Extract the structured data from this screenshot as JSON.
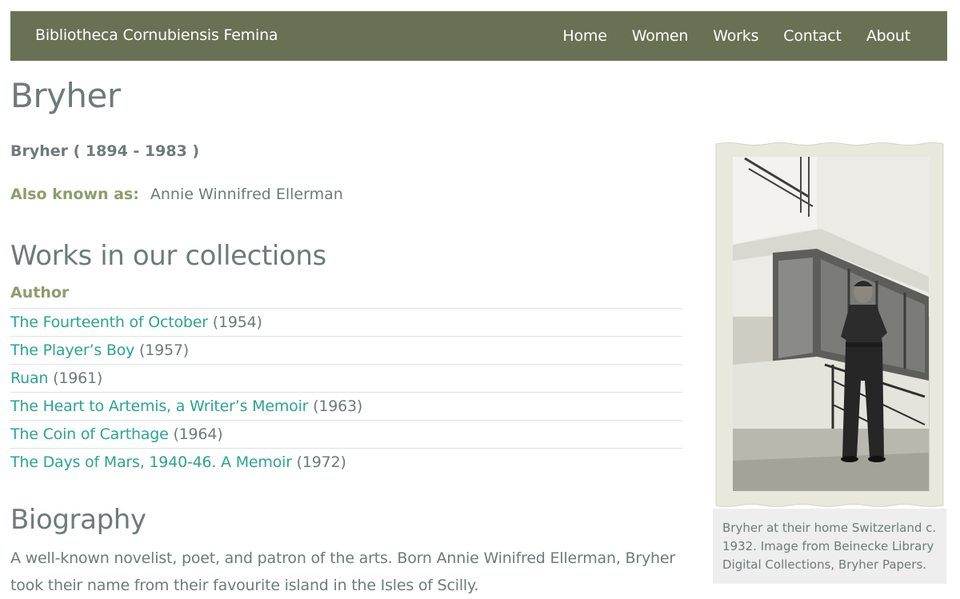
{
  "navbar": {
    "brand": "Bibliotheca Cornubiensis Femina",
    "links": [
      "Home",
      "Women",
      "Works",
      "Contact",
      "About"
    ]
  },
  "page": {
    "title": "Bryher",
    "dates": "Bryher ( 1894 - 1983 )",
    "aka_label": "Also known as:",
    "aka_value": "Annie Winnifred Ellerman"
  },
  "works": {
    "heading": "Works in our collections",
    "role": "Author",
    "items": [
      {
        "title": "The Fourteenth of October",
        "year": "(1954)"
      },
      {
        "title": "The Player’s Boy",
        "year": "(1957)"
      },
      {
        "title": "Ruan",
        "year": "(1961)"
      },
      {
        "title": "The Heart to Artemis, a Writer’s Memoir",
        "year": "(1963)"
      },
      {
        "title": "The Coin of Carthage",
        "year": "(1964)"
      },
      {
        "title": "The Days of Mars, 1940-46. A Memoir",
        "year": "(1972)"
      }
    ]
  },
  "biography": {
    "heading": "Biography",
    "text": "A well-known novelist, poet, and patron of the arts. Born Annie Winifred Ellerman, Bryher took their name from their favourite island in the Isles of Scilly."
  },
  "figure": {
    "caption": "Bryher at their home Switzerland c. 1932. Image from Beinecke Library Digital Collections, Bryher Papers."
  },
  "colors": {
    "navbar_bg": "#697155",
    "link": "#2aa58e",
    "label_green": "#8c9d6c",
    "text": "#6f7a7a"
  }
}
